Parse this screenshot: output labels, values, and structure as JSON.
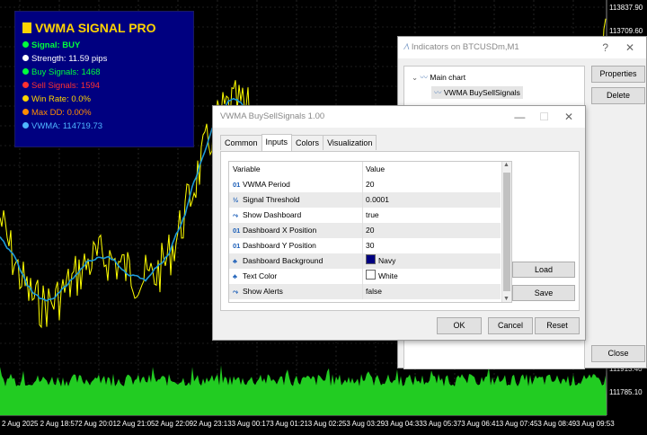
{
  "chart": {
    "price_labels": [
      "113837.90",
      "113709.60",
      "111913.40",
      "111785.10"
    ],
    "time_labels": [
      "2 Aug 2025",
      "2 Aug 18:57",
      "2 Aug 20:01",
      "2 Aug 21:05",
      "2 Aug 22:09",
      "2 Aug 23:13",
      "3 Aug 00:17",
      "3 Aug 01:21",
      "3 Aug 02:25",
      "3 Aug 03:29",
      "3 Aug 04:33",
      "3 Aug 05:37",
      "3 Aug 06:41",
      "3 Aug 07:45",
      "3 Aug 08:49",
      "3 Aug 09:53"
    ],
    "colors": {
      "price": "#ffff00",
      "vwma": "#1e9bd7",
      "volume": "#22cc22",
      "grid": "#3a3a3a"
    }
  },
  "dashboard": {
    "title": "VWMA SIGNAL PRO",
    "rows": [
      {
        "icon": "green-circle-icon",
        "text": "Signal: BUY",
        "color": "#00ff3c",
        "bold": true
      },
      {
        "icon": "strength-icon",
        "text": "Strength: 11.59 pips",
        "color": "#ffffff",
        "bold": false
      },
      {
        "icon": "green-circle-icon",
        "text": "Buy Signals: 1468",
        "color": "#00ff3c",
        "bold": false
      },
      {
        "icon": "red-circle-icon",
        "text": "Sell Signals: 1594",
        "color": "#ff3030",
        "bold": false
      },
      {
        "icon": "target-icon",
        "text": "Win Rate: 0.0%",
        "color": "#ffd400",
        "bold": false
      },
      {
        "icon": "down-icon",
        "text": "Max DD: 0.00%",
        "color": "#ff8c00",
        "bold": false
      },
      {
        "icon": "bar-icon",
        "text": "VWMA: 114719.73",
        "color": "#4fb6ff",
        "bold": false
      }
    ]
  },
  "indicators_window": {
    "title": "Indicators on BTCUSDm,M1",
    "tree_root": "Main chart",
    "tree_child": "VWMA BuySellSignals",
    "buttons": {
      "properties": "Properties",
      "delete": "Delete",
      "close": "Close"
    },
    "title_buttons": {
      "help": "?",
      "close": "✕"
    }
  },
  "properties_window": {
    "title": "VWMA BuySellSignals 1.00",
    "tabs": [
      "Common",
      "Inputs",
      "Colors",
      "Visualization"
    ],
    "active_tab": "Inputs",
    "grid_headers": {
      "variable": "Variable",
      "value": "Value"
    },
    "rows": [
      {
        "icon": "01",
        "name": "VWMA Period",
        "value": "20"
      },
      {
        "icon": "½",
        "name": "Signal Threshold",
        "value": "0.0001"
      },
      {
        "icon": "⤳",
        "name": "Show Dashboard",
        "value": "true"
      },
      {
        "icon": "01",
        "name": "Dashboard X Position",
        "value": "20"
      },
      {
        "icon": "01",
        "name": "Dashboard Y Position",
        "value": "30"
      },
      {
        "icon": "♣",
        "name": "Dashboard Background",
        "value": "Navy",
        "swatch": "#000080"
      },
      {
        "icon": "♣",
        "name": "Text Color",
        "value": "White",
        "swatch": "#ffffff"
      },
      {
        "icon": "⤳",
        "name": "Show Alerts",
        "value": "false"
      }
    ],
    "buttons": {
      "load": "Load",
      "save": "Save",
      "ok": "OK",
      "cancel": "Cancel",
      "reset": "Reset"
    },
    "title_buttons": {
      "minimize": "—",
      "maximize": "☐",
      "close": "✕"
    }
  }
}
